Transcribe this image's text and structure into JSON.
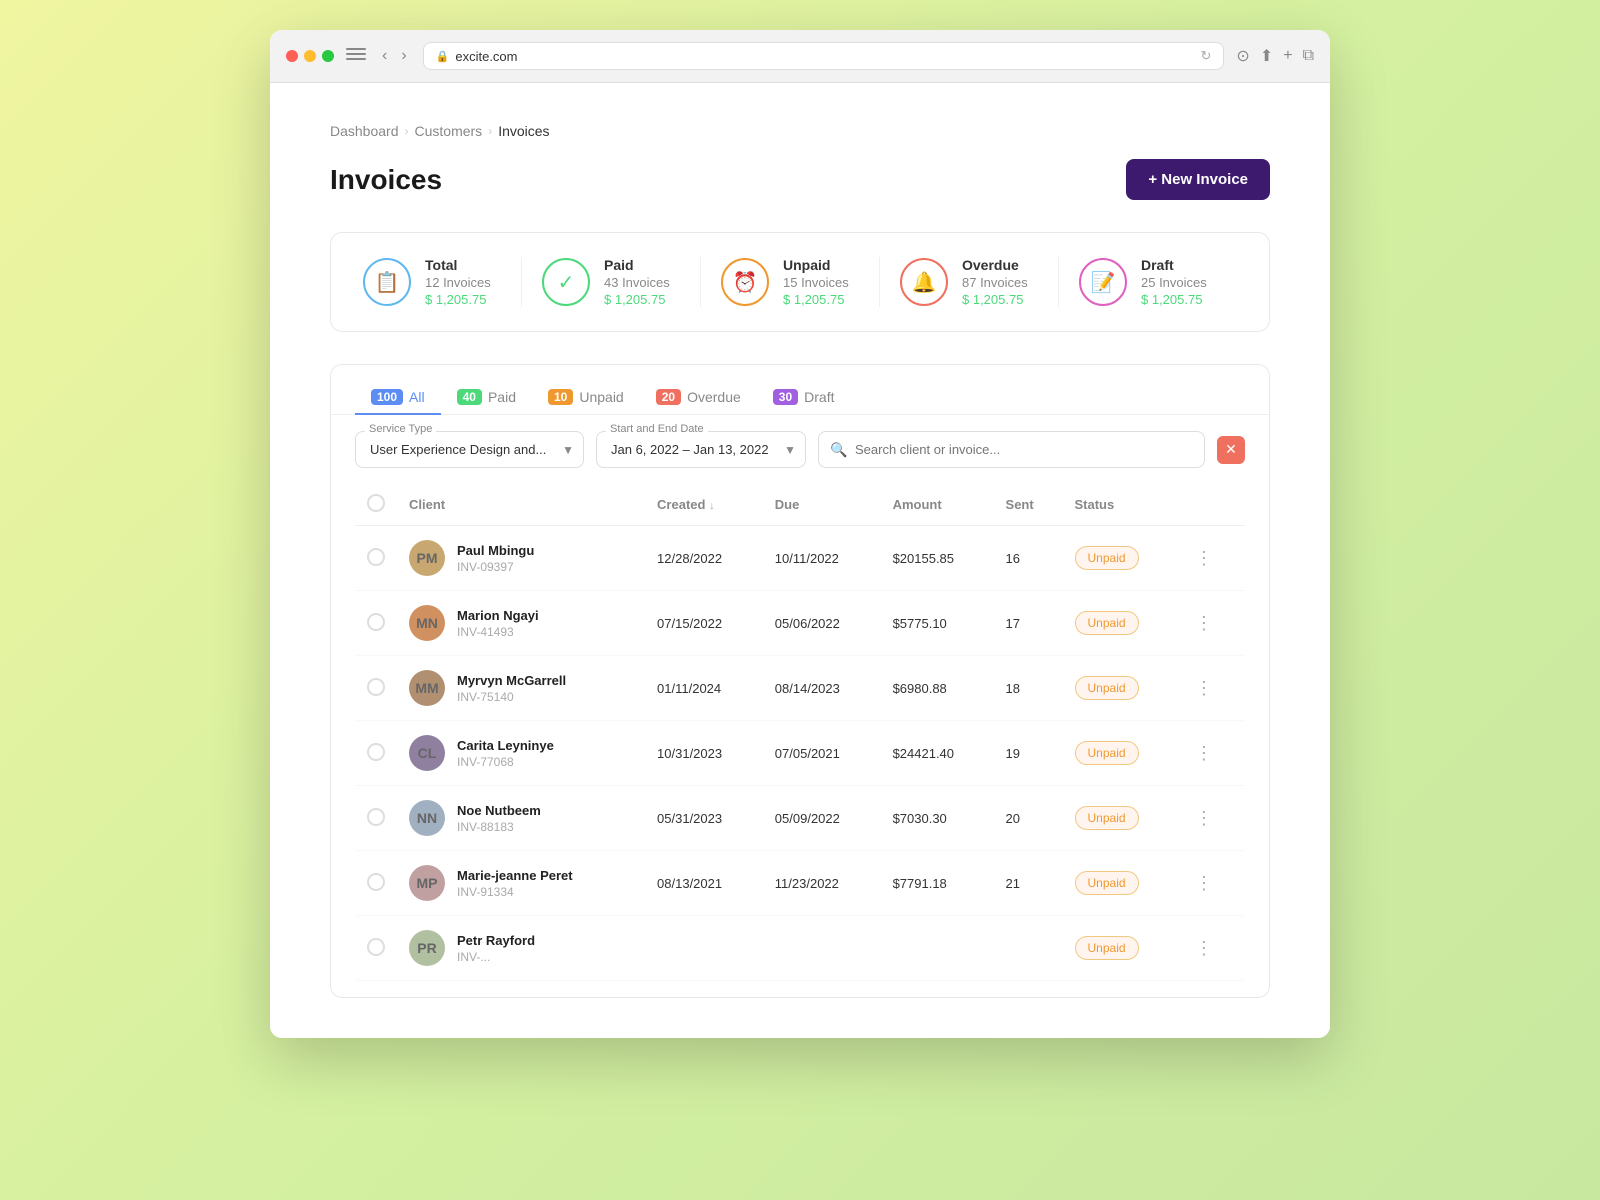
{
  "browser": {
    "url": "excite.com",
    "title": "Invoices"
  },
  "breadcrumb": {
    "items": [
      {
        "label": "Dashboard",
        "active": false
      },
      {
        "label": "Customers",
        "active": false
      },
      {
        "label": "Invoices",
        "active": true
      }
    ]
  },
  "page": {
    "title": "Invoices",
    "new_invoice_label": "+ New Invoice"
  },
  "stats": [
    {
      "id": "total",
      "icon": "📋",
      "icon_type": "blue",
      "label": "Total",
      "count": "12 Invoices",
      "amount": "$ 1,205.75"
    },
    {
      "id": "paid",
      "icon": "✓",
      "icon_type": "green",
      "label": "Paid",
      "count": "43 Invoices",
      "amount": "$ 1,205.75"
    },
    {
      "id": "unpaid",
      "icon": "⏰",
      "icon_type": "orange",
      "label": "Unpaid",
      "count": "15 Invoices",
      "amount": "$ 1,205.75"
    },
    {
      "id": "overdue",
      "icon": "🔔",
      "icon_type": "red",
      "label": "Overdue",
      "count": "87 Invoices",
      "amount": "$ 1,205.75"
    },
    {
      "id": "draft",
      "icon": "📝",
      "icon_type": "pink",
      "label": "Draft",
      "count": "25 Invoices",
      "amount": "$ 1,205.75"
    }
  ],
  "tabs": [
    {
      "id": "all",
      "count": "100",
      "label": "All",
      "active": true,
      "class": ""
    },
    {
      "id": "paid",
      "count": "40",
      "label": "Paid",
      "active": false,
      "class": "paid"
    },
    {
      "id": "unpaid",
      "count": "10",
      "label": "Unpaid",
      "active": false,
      "class": "unpaid"
    },
    {
      "id": "overdue",
      "count": "20",
      "label": "Overdue",
      "active": false,
      "class": "overdue"
    },
    {
      "id": "draft",
      "count": "30",
      "label": "Draft",
      "active": false,
      "class": "draft"
    }
  ],
  "filters": {
    "service_type_label": "Service Type",
    "service_type_value": "User Experience Design and...",
    "date_range_label": "Start and End Date",
    "date_range_value": "Jan 6, 2022 – Jan 13, 2022",
    "search_placeholder": "Search client or invoice..."
  },
  "table": {
    "columns": [
      "",
      "Client",
      "Created",
      "Due",
      "Amount",
      "Sent",
      "Status",
      ""
    ],
    "rows": [
      {
        "name": "Paul Mbingu",
        "inv": "INV-09397",
        "created": "12/28/2022",
        "due": "10/11/2022",
        "amount": "$20155.85",
        "sent": "16",
        "status": "Unpaid",
        "initials": "PM",
        "avatar_class": "avatar-1"
      },
      {
        "name": "Marion Ngayi",
        "inv": "INV-41493",
        "created": "07/15/2022",
        "due": "05/06/2022",
        "amount": "$5775.10",
        "sent": "17",
        "status": "Unpaid",
        "initials": "MN",
        "avatar_class": "avatar-2"
      },
      {
        "name": "Myrvyn McGarrell",
        "inv": "INV-75140",
        "created": "01/11/2024",
        "due": "08/14/2023",
        "amount": "$6980.88",
        "sent": "18",
        "status": "Unpaid",
        "initials": "MM",
        "avatar_class": "avatar-3"
      },
      {
        "name": "Carita Leyninye",
        "inv": "INV-77068",
        "created": "10/31/2023",
        "due": "07/05/2021",
        "amount": "$24421.40",
        "sent": "19",
        "status": "Unpaid",
        "initials": "CL",
        "avatar_class": "avatar-4"
      },
      {
        "name": "Noe Nutbeem",
        "inv": "INV-88183",
        "created": "05/31/2023",
        "due": "05/09/2022",
        "amount": "$7030.30",
        "sent": "20",
        "status": "Unpaid",
        "initials": "NN",
        "avatar_class": "avatar-5"
      },
      {
        "name": "Marie-jeanne Peret",
        "inv": "INV-91334",
        "created": "08/13/2021",
        "due": "11/23/2022",
        "amount": "$7791.18",
        "sent": "21",
        "status": "Unpaid",
        "initials": "MP",
        "avatar_class": "avatar-6"
      },
      {
        "name": "Petr Rayford",
        "inv": "INV-...",
        "created": "...",
        "due": "...",
        "amount": "...",
        "sent": "...",
        "status": "Unpaid",
        "initials": "PR",
        "avatar_class": "avatar-7"
      }
    ]
  }
}
